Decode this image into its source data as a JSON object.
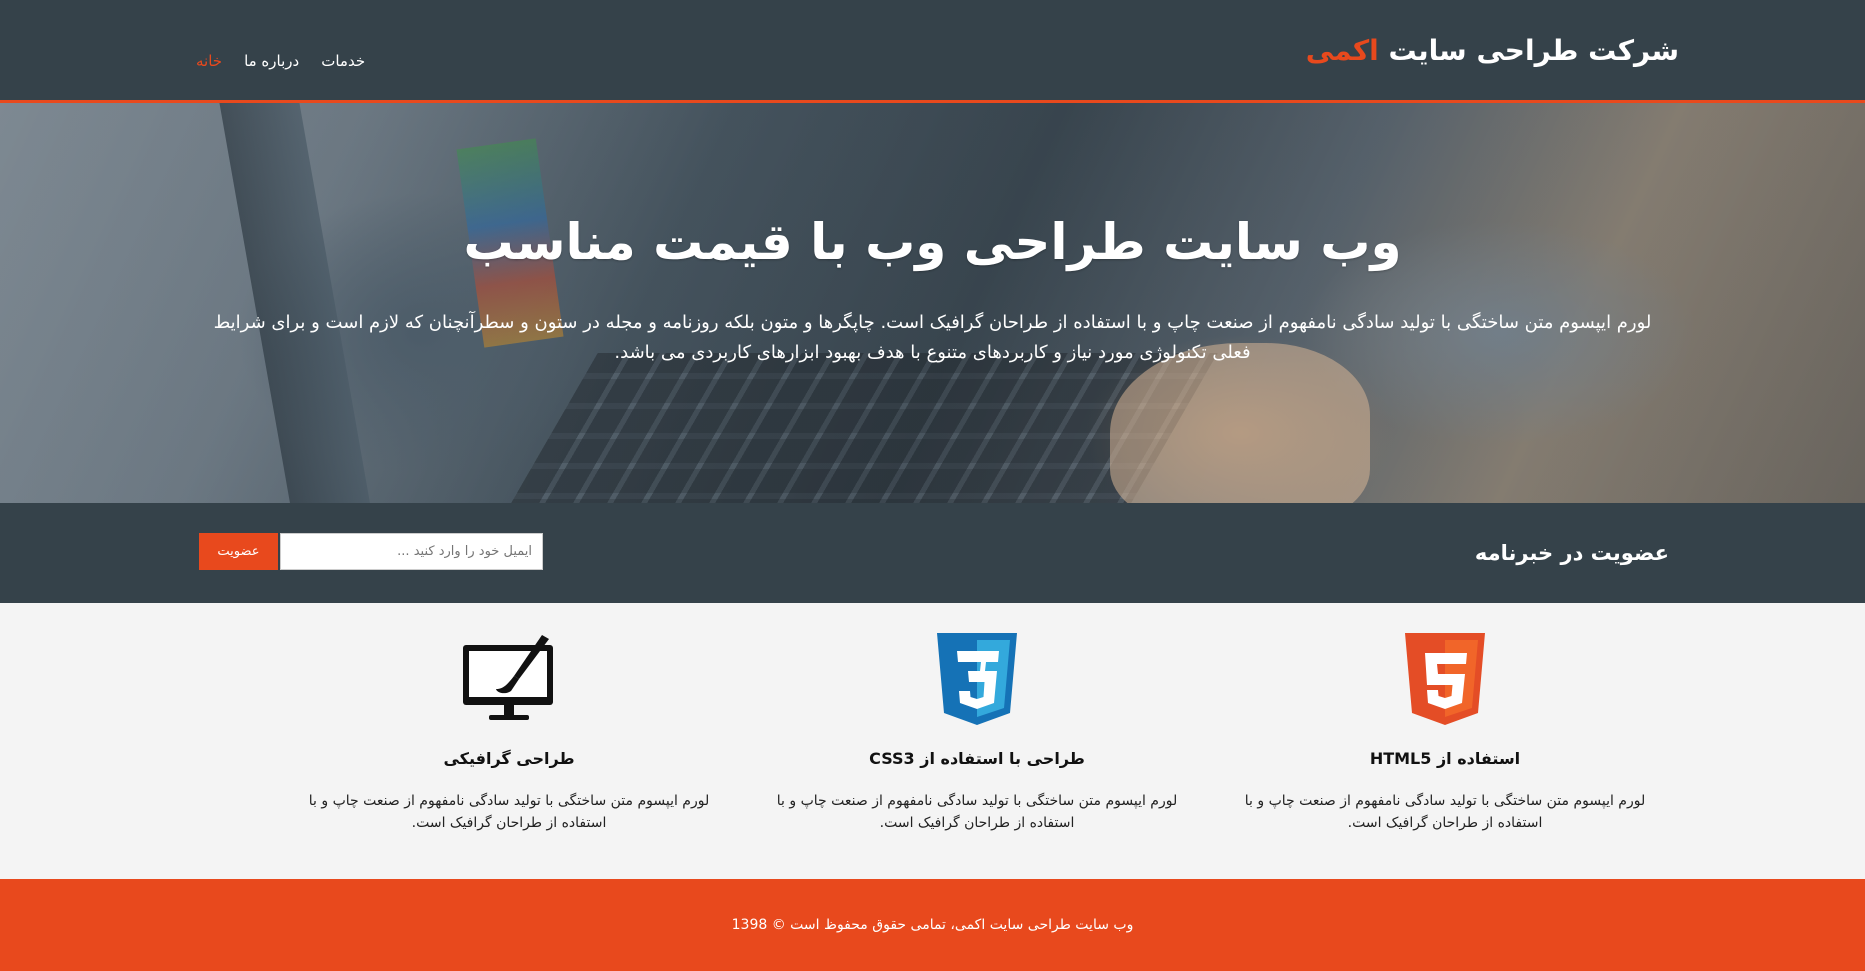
{
  "header": {
    "brand_main": "شرکت طراحی سایت",
    "brand_highlight": "اکمی",
    "nav": [
      {
        "label": "خانه",
        "active": true
      },
      {
        "label": "درباره ما",
        "active": false
      },
      {
        "label": "خدمات",
        "active": false
      }
    ]
  },
  "showcase": {
    "title": "وب سایت طراحی وب با قیمت مناسب",
    "text": "لورم ایپسوم متن ساختگی با تولید سادگی نامفهوم از صنعت چاپ و با استفاده از طراحان گرافیک است. چاپگرها و متون بلکه روزنامه و مجله در ستون و سطرآنچنان که لازم است و برای شرایط فعلی تکنولوژی مورد نیاز و کاربردهای متنوع با هدف بهبود ابزارهای کاربردی می باشد."
  },
  "newsletter": {
    "title": "عضویت در خبرنامه",
    "email_placeholder": "ایمیل خود را وارد کنید ...",
    "email_value": "",
    "submit_label": "عضویت"
  },
  "boxes": [
    {
      "icon": "html5-icon",
      "title": "استفاده از HTML5",
      "text": "لورم ایپسوم متن ساختگی با تولید سادگی نامفهوم از صنعت چاپ و با استفاده از طراحان گرافیک است."
    },
    {
      "icon": "css3-icon",
      "title": "طراحی با استفاده از CSS3",
      "text": "لورم ایپسوم متن ساختگی با تولید سادگی نامفهوم از صنعت چاپ و با استفاده از طراحان گرافیک است."
    },
    {
      "icon": "graphic-design-icon",
      "title": "طراحی گرافیکی",
      "text": "لورم ایپسوم متن ساختگی با تولید سادگی نامفهوم از صنعت چاپ و با استفاده از طراحان گرافیک است."
    }
  ],
  "footer": {
    "text": "وب سایت طراحی سایت اکمی، تمامی حقوق محفوظ است © 1398"
  },
  "colors": {
    "accent": "#e8491d",
    "dark": "#35424a",
    "light_bg": "#f4f4f4",
    "html5_orange": "#e44d26",
    "css3_blue": "#1572b6"
  }
}
